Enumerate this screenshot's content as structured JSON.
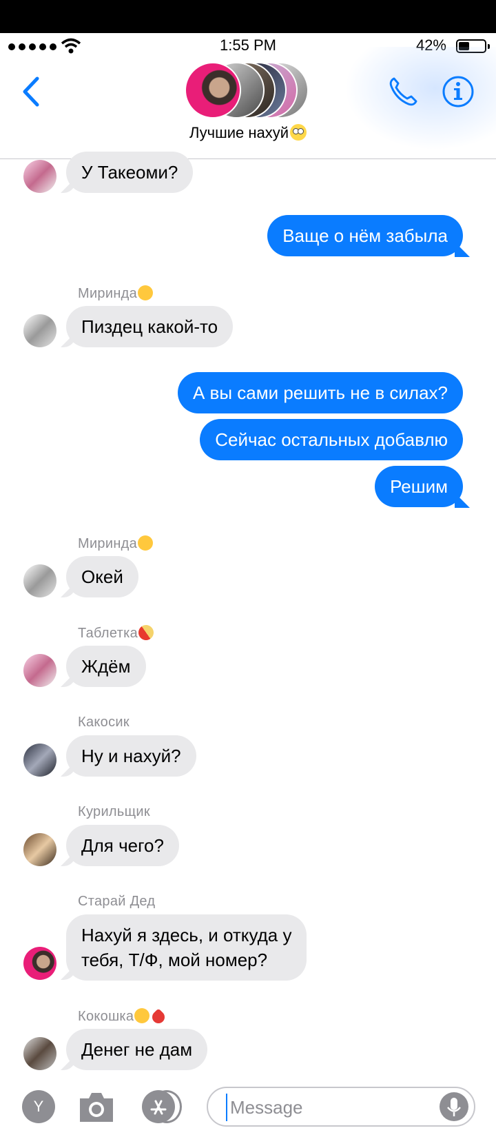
{
  "status": {
    "time": "1:55 PM",
    "battery": "42%",
    "battery_level": 0.42
  },
  "header": {
    "back_icon": "chevron-left-icon",
    "title": "Лучшие нахуй",
    "title_emoji": "eye-roll-emoji",
    "call_icon": "phone-icon",
    "info_icon": "info-icon"
  },
  "colors": {
    "accent": "#0a7cff",
    "incoming_bubble": "#e9e9eb",
    "sender_gray": "#8e8e93"
  },
  "messages": [
    {
      "dir": "in",
      "text": "У Такеоми?",
      "avatar": "pink-avatar"
    },
    {
      "dir": "out",
      "text": "Ваще о нём забыла"
    },
    {
      "dir": "in",
      "sender": "Миринда",
      "sender_emoji": "kissing-face",
      "text": "Пиздец какой-то",
      "avatar": "sketch-avatar"
    },
    {
      "dir": "out",
      "text": "А вы сами решить не в силах?"
    },
    {
      "dir": "out",
      "text": "Сейчас остальных добавлю"
    },
    {
      "dir": "out",
      "text": "Решим"
    },
    {
      "dir": "in",
      "sender": "Миринда",
      "sender_emoji": "kissing-face",
      "text": "Окей",
      "avatar": "sketch-avatar"
    },
    {
      "dir": "in",
      "sender": "Таблетка",
      "sender_emoji": "pill",
      "text": "Ждём",
      "avatar": "pink-avatar"
    },
    {
      "dir": "in",
      "sender": "Какосик",
      "text": "Ну и нахуй?",
      "avatar": "dark-hair-avatar"
    },
    {
      "dir": "in",
      "sender": "Курильщик",
      "text": "Для чего?",
      "avatar": "brown-avatar"
    },
    {
      "dir": "in",
      "sender": "Старай Дед",
      "text_line1": "Нахуй я здесь, и откуда у",
      "text_line2": "тебя, Т/Ф, мой номер?",
      "avatar": "magenta-avatar"
    },
    {
      "dir": "in",
      "sender": "Кокошка",
      "sender_emoji": "kiss-heart",
      "text": "Денег не дам",
      "avatar": "bw-avatar"
    }
  ],
  "composer": {
    "apps_label": "Y",
    "camera_icon": "camera-icon",
    "appstore_icon": "app-store-icon",
    "placeholder": "Message",
    "mic_icon": "microphone-icon"
  }
}
